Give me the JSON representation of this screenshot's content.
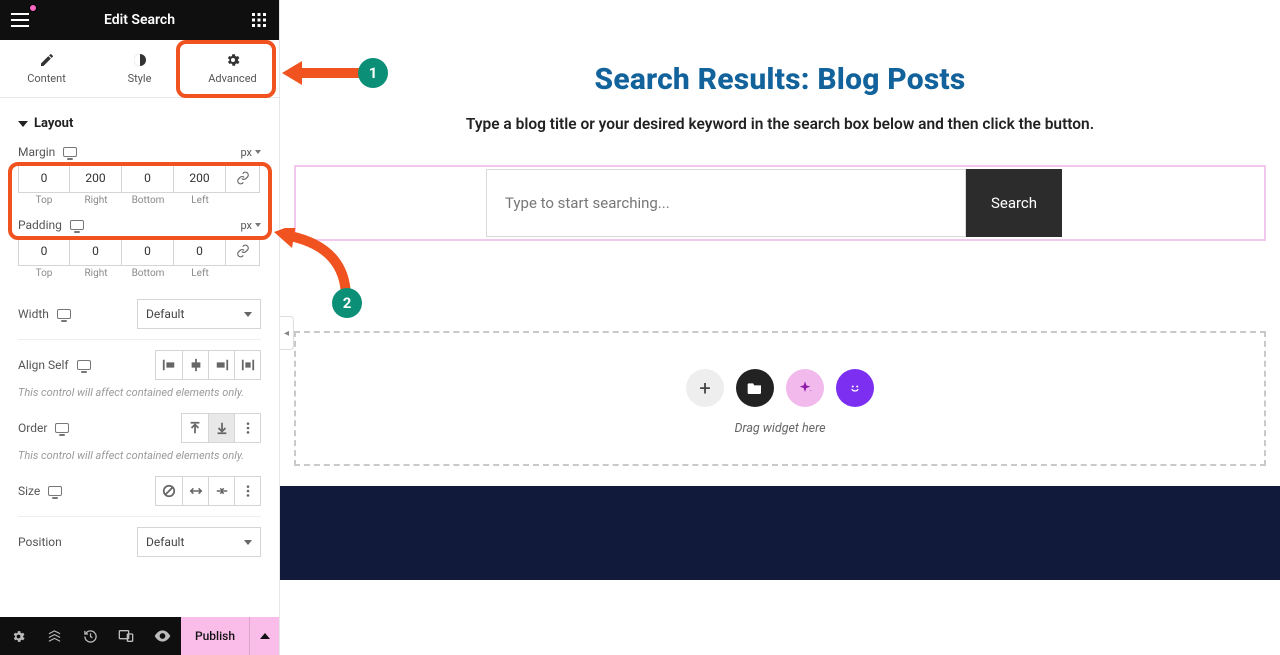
{
  "header": {
    "title": "Edit Search"
  },
  "tabs": {
    "content": "Content",
    "style": "Style",
    "advanced": "Advanced"
  },
  "section": {
    "layout": "Layout"
  },
  "margin": {
    "label": "Margin",
    "unit": "px",
    "top": "0",
    "right": "200",
    "bottom": "0",
    "left": "200",
    "top_lbl": "Top",
    "right_lbl": "Right",
    "bottom_lbl": "Bottom",
    "left_lbl": "Left"
  },
  "padding": {
    "label": "Padding",
    "unit": "px",
    "top": "0",
    "right": "0",
    "bottom": "0",
    "left": "0",
    "top_lbl": "Top",
    "right_lbl": "Right",
    "bottom_lbl": "Bottom",
    "left_lbl": "Left"
  },
  "width": {
    "label": "Width",
    "value": "Default"
  },
  "align_self": {
    "label": "Align Self"
  },
  "order": {
    "label": "Order"
  },
  "size": {
    "label": "Size"
  },
  "position": {
    "label": "Position",
    "value": "Default"
  },
  "note_contained": "This control will affect contained elements only.",
  "footer": {
    "publish": "Publish"
  },
  "preview": {
    "title": "Search Results: Blog Posts",
    "subtitle": "Type a blog title or your desired keyword in the search box below and then click the button.",
    "search_placeholder": "Type to start searching...",
    "search_button": "Search",
    "drop_text": "Drag widget here"
  },
  "annotations": {
    "step1": "1",
    "step2": "2"
  }
}
